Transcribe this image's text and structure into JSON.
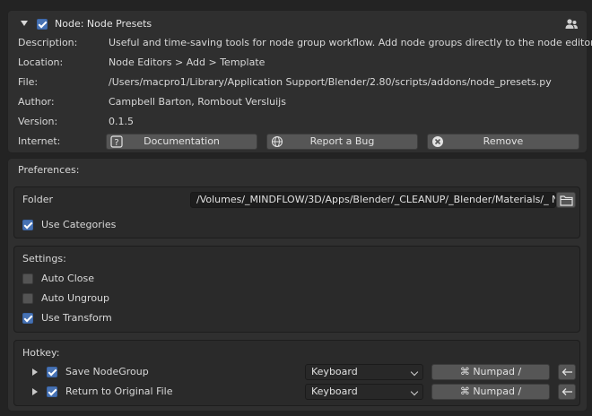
{
  "addon": {
    "title": "Node: Node Presets",
    "description_label": "Description:",
    "description": "Useful and time-saving tools for node group workflow. Add node groups directly to the node editors",
    "location_label": "Location:",
    "location": "Node Editors > Add > Template",
    "file_label": "File:",
    "file": "/Users/macpro1/Library/Application Support/Blender/2.80/scripts/addons/node_presets.py",
    "author_label": "Author:",
    "author": "Campbell Barton, Rombout Versluijs",
    "version_label": "Version:",
    "version": "0.1.5",
    "internet_label": "Internet:",
    "buttons": {
      "documentation": "Documentation",
      "report_bug": "Report a Bug",
      "remove": "Remove"
    }
  },
  "preferences": {
    "label": "Preferences:",
    "folder_label": "Folder",
    "folder_value": "/Volumes/_MINDFLOW/3D/Apps/Blender/_CLEANUP/_Blender/Materials/_ Node ...",
    "use_categories": "Use Categories"
  },
  "settings": {
    "label": "Settings:",
    "auto_close": "Auto Close",
    "auto_ungroup": "Auto Ungroup",
    "use_transform": "Use Transform"
  },
  "hotkey": {
    "label": "Hotkey:",
    "rows": [
      {
        "name": "Save NodeGroup",
        "device": "Keyboard",
        "key": "⌘ Numpad /"
      },
      {
        "name": "Return to Original File",
        "device": "Keyboard",
        "key": "⌘ Numpad /"
      }
    ]
  },
  "colors": {
    "checkbox_on": "#4772b3",
    "button": "#565656",
    "panel": "#2f2f2f"
  }
}
